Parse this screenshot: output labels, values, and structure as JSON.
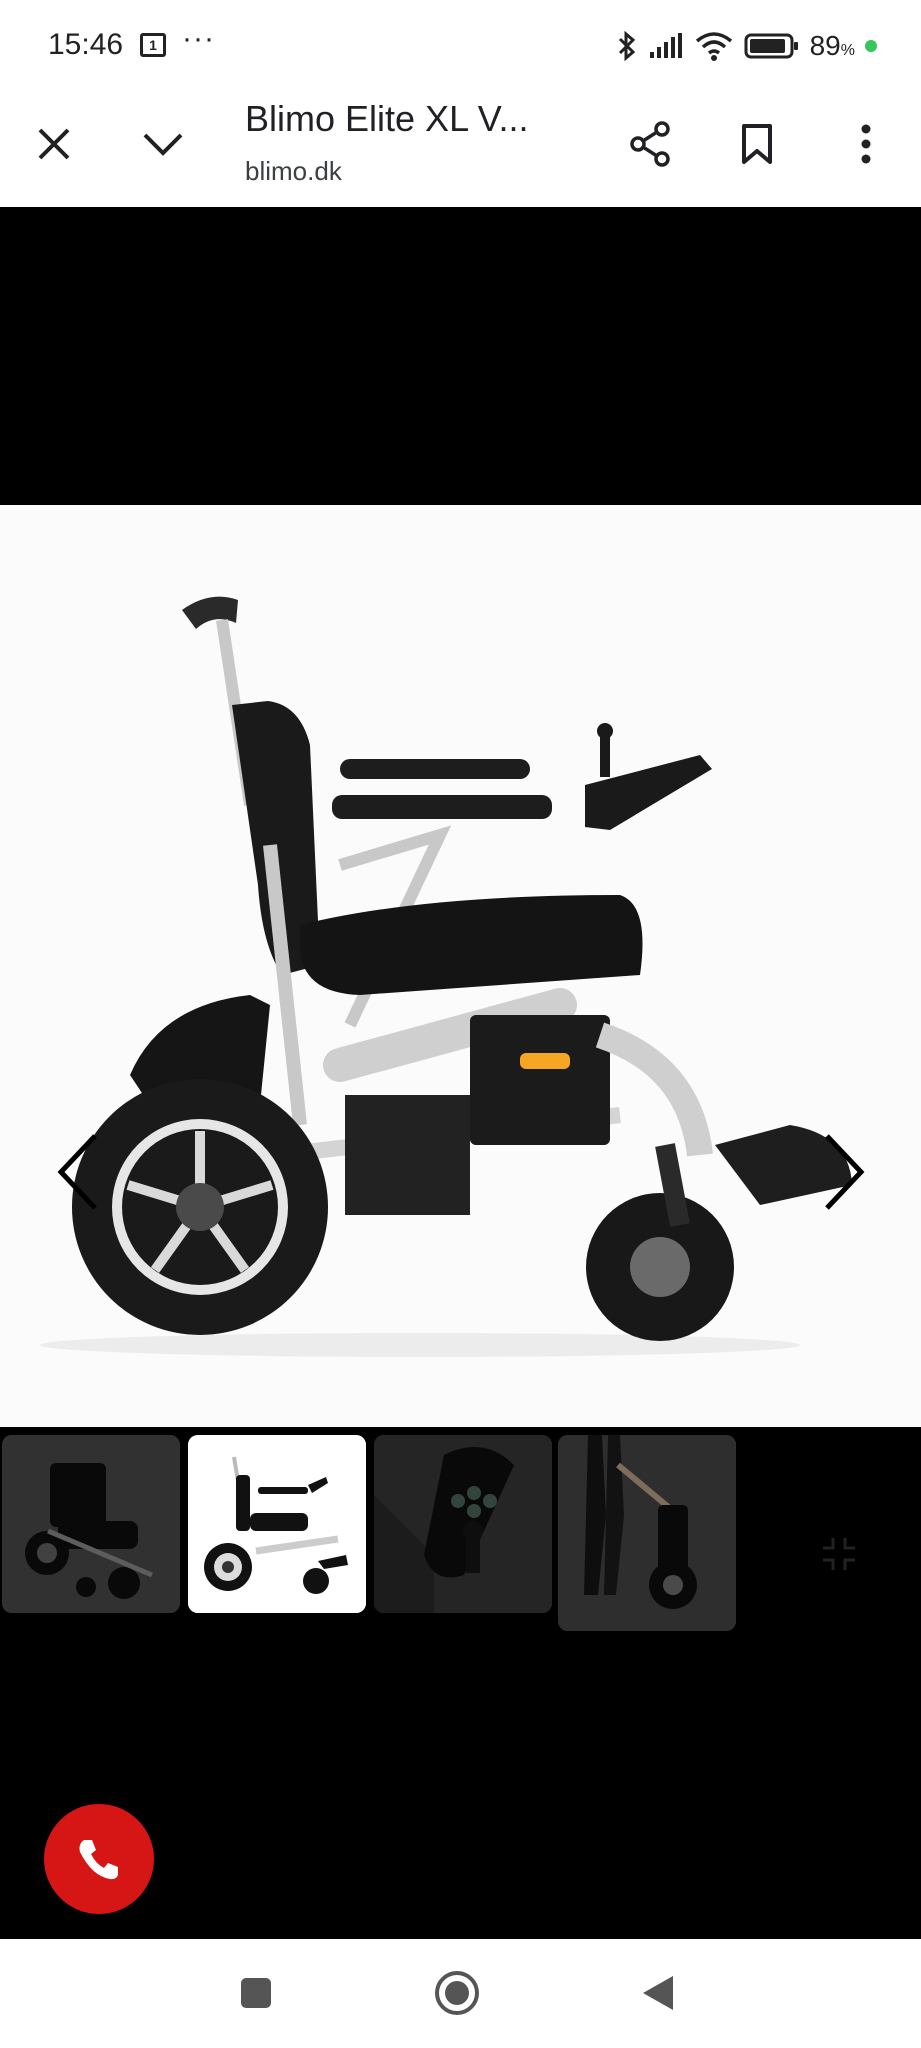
{
  "status_bar": {
    "time": "15:46",
    "calendar_day": "1",
    "more": "···",
    "battery_percent": "89",
    "battery_unit": "%"
  },
  "app_bar": {
    "title": "Blimo Elite XL V...",
    "domain": "blimo.dk",
    "icons": [
      "close-icon",
      "chevron-down-icon",
      "share-icon",
      "bookmark-icon",
      "more-vert-icon"
    ]
  },
  "viewer": {
    "image_subject": "wheelchair-side-view",
    "thumbnails": [
      {
        "subject": "wheelchair-front-angle",
        "selected": false
      },
      {
        "subject": "wheelchair-side-view",
        "selected": true
      },
      {
        "subject": "joystick-controller",
        "selected": false
      },
      {
        "subject": "person-folding-wheelchair",
        "selected": false
      }
    ]
  },
  "fab": {
    "icon": "phone-icon",
    "color": "#d61515"
  },
  "nav_bar": {
    "icons": [
      "recents-icon",
      "home-icon",
      "back-icon"
    ]
  },
  "colors": {
    "accent_charge": "#34c759",
    "viewer_bg": "#000000"
  }
}
